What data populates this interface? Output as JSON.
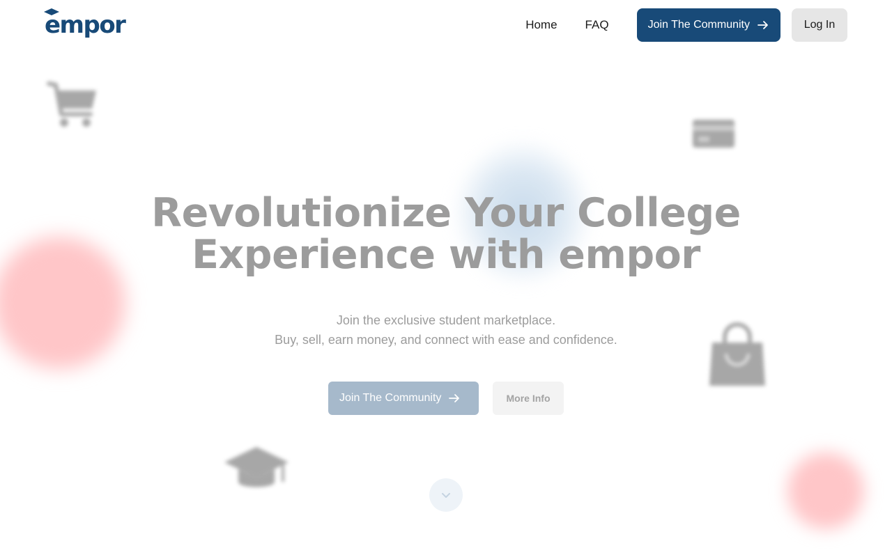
{
  "brand": {
    "logo_text": "empor",
    "color": "#184a78"
  },
  "nav": {
    "home": "Home",
    "faq": "FAQ",
    "join": "Join The Community",
    "login": "Log In"
  },
  "hero": {
    "title_line1": "Revolutionize Your College",
    "title_line2": "Experience with empor",
    "subtitle_line1": "Join the exclusive student marketplace.",
    "subtitle_line2": "Buy, sell, earn money, and connect with ease and confidence.",
    "primary_button": "Join The Community",
    "secondary_button": "More Info"
  },
  "decor": {
    "icons": [
      "shopping-cart-icon",
      "credit-card-icon",
      "shopping-bag-icon",
      "graduation-cap-icon"
    ],
    "scroll_icon": "chevron-down-icon"
  },
  "colors": {
    "accent": "#184a78",
    "accent_faded": "#a6b9cb",
    "blob_pink": "#ffc6c8",
    "blob_blue": "#c9dbec"
  }
}
